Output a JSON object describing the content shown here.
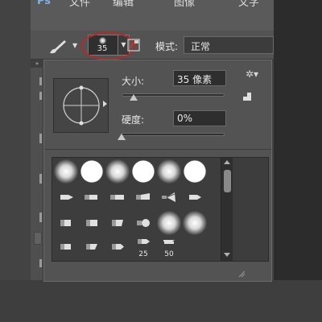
{
  "app": {
    "menu_items": [
      "文件",
      "编辑",
      "图像",
      "文字"
    ]
  },
  "options_bar": {
    "brush_size_number": "35",
    "mode_label": "模式:",
    "mode_value": "正常"
  },
  "brush_popup": {
    "size_label": "大小:",
    "size_value": "35 像素",
    "size_slider_fraction": 0.12,
    "hardness_label": "硬度:",
    "hardness_value": "0%",
    "hardness_slider_fraction": 0.0
  },
  "brush_grid": {
    "numbered_labels": [
      "25",
      "50"
    ]
  },
  "colors": {
    "highlight_ellipse": "#b52a2a",
    "panel_bg": "#535353",
    "grid_bg": "#3d3d3d"
  },
  "icons": [
    "brush-tool-icon",
    "brush-panel-toggle-icon",
    "gear-icon",
    "new-preset-icon",
    "crosshair-icon",
    "scroll-up-icon",
    "scroll-down-icon"
  ]
}
